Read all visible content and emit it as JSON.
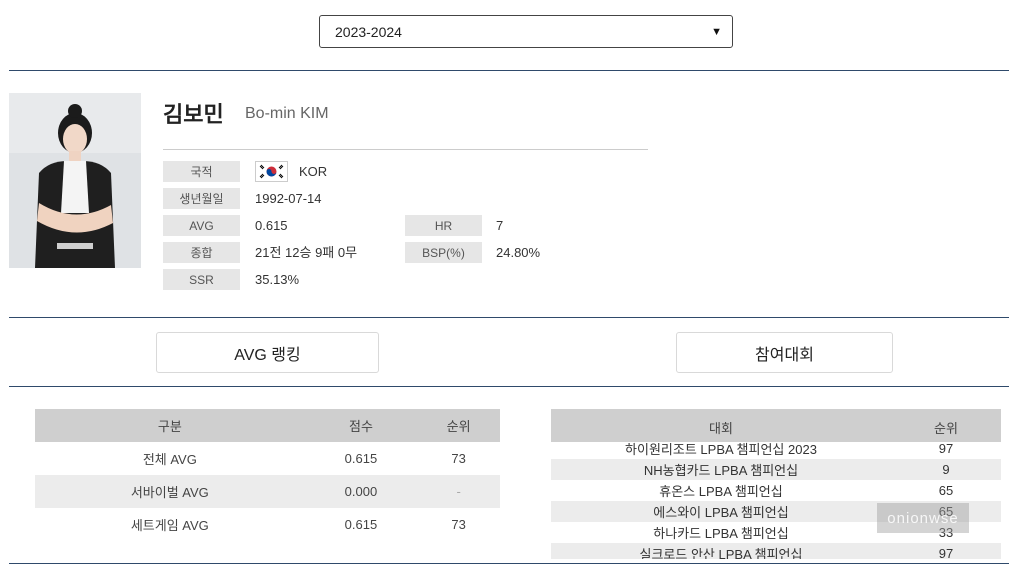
{
  "season": {
    "selected": "2023-2024"
  },
  "player": {
    "name_ko": "김보민",
    "name_en": "Bo-min KIM",
    "fields": {
      "nationality_label": "국적",
      "nationality_value": "KOR",
      "birth_label": "생년월일",
      "birth_value": "1992-07-14",
      "avg_label": "AVG",
      "avg_value": "0.615",
      "hr_label": "HR",
      "hr_value": "7",
      "record_label": "종합",
      "record_value": "21전 12승 9패 0무",
      "bsp_label": "BSP(%)",
      "bsp_value": "24.80%",
      "ssr_label": "SSR",
      "ssr_value": "35.13%"
    }
  },
  "tabs": {
    "avg_ranking": "AVG 랭킹",
    "tournaments": "참여대회"
  },
  "avg_table": {
    "headers": [
      "구분",
      "점수",
      "순위"
    ],
    "rows": [
      [
        "전체 AVG",
        "0.615",
        "73"
      ],
      [
        "서바이벌 AVG",
        "0.000",
        "-"
      ],
      [
        "세트게임 AVG",
        "0.615",
        "73"
      ]
    ]
  },
  "tournament_table": {
    "headers": [
      "대회",
      "순위"
    ],
    "rows": [
      [
        "하이원리조트 LPBA 챔피언십 2023",
        "97"
      ],
      [
        "NH농협카드 LPBA 챔피언십",
        "9"
      ],
      [
        "휴온스 LPBA 챔피언십",
        "65"
      ],
      [
        "에스와이 LPBA 챔피언십",
        "65"
      ],
      [
        "하나카드 LPBA 챔피언십",
        "33"
      ],
      [
        "실크로드 안산 LPBA 챔피언십",
        "97"
      ]
    ]
  },
  "watermark": "onionwse"
}
